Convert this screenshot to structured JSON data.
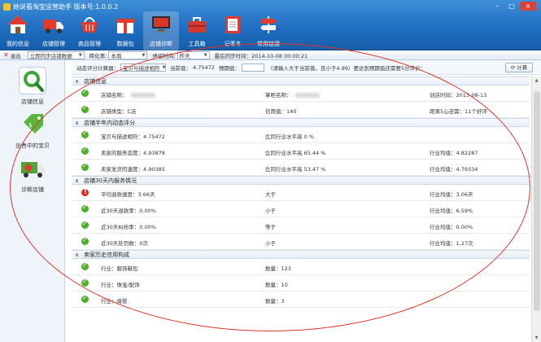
{
  "app": {
    "title": "她说看淘宝运营助手 版本号:1.0.0.2"
  },
  "window_buttons": [
    "–",
    "□",
    "×"
  ],
  "toolbar": [
    {
      "label": "我的信息",
      "icon": "house-icon",
      "active": false
    },
    {
      "label": "店铺管理",
      "icon": "truck-icon",
      "active": false
    },
    {
      "label": "商品管理",
      "icon": "basket-icon",
      "active": false
    },
    {
      "label": "数据包",
      "icon": "gift-box-icon",
      "active": false
    },
    {
      "label": "店铺诊断",
      "icon": "monitor-icon",
      "active": true
    },
    {
      "label": "工具箱",
      "icon": "toolbox-icon",
      "active": false
    },
    {
      "label": "记事本",
      "icon": "notebook-icon",
      "active": false
    },
    {
      "label": "常用链接",
      "icon": "signpost-icon",
      "active": false
    }
  ],
  "bar2": {
    "exit_label": "退出",
    "sync_select": "立即同步店铺数据",
    "period_label": "砖化率:",
    "period_value": "本周",
    "stop_label": "停留时间:",
    "stop_value": "昨天",
    "last_sync": "最后同步时间：2014-10-08 00:00:21"
  },
  "sidebar": [
    {
      "label": "店铺信息",
      "icon": "magnifier-icon",
      "active": true
    },
    {
      "label": "出售中的宝贝",
      "icon": "price-tag-icon",
      "active": false
    },
    {
      "label": "诊断店铺",
      "icon": "ambulance-icon",
      "active": false
    }
  ],
  "calc_bar": {
    "label": "动态评分计算器：",
    "select_value": "宝贝与描述相符",
    "current_label": "当前值：",
    "current_value": "4.75472",
    "target_label": "预期值：",
    "hint": "（请输入大于当前值，且小于4.99）要达到预期值还需要5分评价：",
    "calc_button": "计算"
  },
  "sections": [
    {
      "title": "店铺信息",
      "rows": [
        {
          "status": "ok",
          "c1": "店铺名称：",
          "c1_blur": true,
          "c2": "掌柜名称：",
          "c2_blur": true,
          "c3": "创店时间：2013-08-13"
        },
        {
          "status": "ok",
          "c1": "店铺类型：C店",
          "c1_blur": false,
          "c2": "信用值：140",
          "c2_blur": false,
          "c3": "距离5心还需：11个好评"
        }
      ]
    },
    {
      "title": "店铺半年内动态评分",
      "rows": [
        {
          "status": "ok",
          "c1": "宝贝与描述相符：4.75472",
          "c1_blur": false,
          "c2": "比同行业水平高 0 %",
          "c2_blur": false,
          "c3": ""
        },
        {
          "status": "ok",
          "c1": "卖家的服务态度：4.93878",
          "c1_blur": false,
          "c2": "比同行业水平高 65.44 %",
          "c2_blur": false,
          "c3": "行业均值：4.82287"
        },
        {
          "status": "ok",
          "c1": "卖家发货的速度：4.90385",
          "c1_blur": false,
          "c2": "比同行业水平高 53.47 %",
          "c2_blur": false,
          "c3": "行业均值：4.79334"
        }
      ]
    },
    {
      "title": "店铺30天内服务情况",
      "rows": [
        {
          "status": "bad",
          "c1": "平均退款速度：3.66天",
          "c1_blur": false,
          "c2": "大于",
          "c2_blur": false,
          "c3": "行业均值：3.06天"
        },
        {
          "status": "ok",
          "c1": "近30天退款率：0.00%",
          "c1_blur": false,
          "c2": "小于",
          "c2_blur": false,
          "c3": "行业均值：6.59%"
        },
        {
          "status": "ok",
          "c1": "近30天纠纷率：0.00%",
          "c1_blur": false,
          "c2": "等于",
          "c2_blur": false,
          "c3": "行业均值：0.00%"
        },
        {
          "status": "ok",
          "c1": "近30天处罚数：0次",
          "c1_blur": false,
          "c2": "小于",
          "c2_blur": false,
          "c3": "行业均值：1.27次"
        }
      ]
    },
    {
      "title": "卖家历史信用构成",
      "rows": [
        {
          "status": "ok",
          "c1": "行业：服饰鞋包",
          "c1_blur": false,
          "c2": "数量：123",
          "c2_blur": false,
          "c3": ""
        },
        {
          "status": "ok",
          "c1": "行业：珠宝/配饰",
          "c1_blur": false,
          "c2": "数量：10",
          "c2_blur": false,
          "c3": ""
        },
        {
          "status": "ok",
          "c1": "行业：母婴",
          "c1_blur": false,
          "c2": "数量：3",
          "c2_blur": false,
          "c3": ""
        }
      ]
    }
  ],
  "colors": {
    "titlebar": "#1d6cc0",
    "annotation": "#e0322a",
    "ok": "#4fae2a",
    "bad": "#d92b20"
  }
}
